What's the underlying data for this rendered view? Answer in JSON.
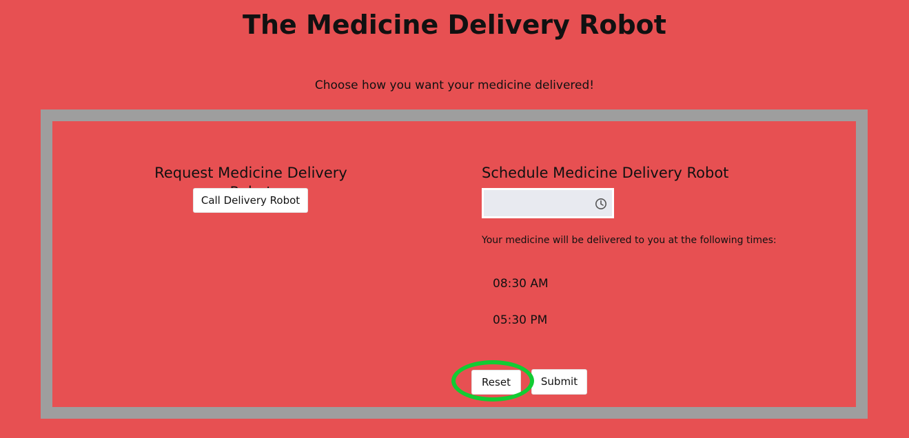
{
  "page": {
    "title": "The Medicine Delivery Robot",
    "subtitle": "Choose how you want your medicine delivered!"
  },
  "request_section": {
    "title": "Request Medicine Delivery Robot",
    "call_button_label": "Call Delivery Robot"
  },
  "schedule_section": {
    "title": "Schedule Medicine Delivery Robot",
    "time_input": {
      "value": "",
      "icon": "clock-icon"
    },
    "info_text": "Your medicine will be delivered to you at the following times:",
    "times": [
      "08:30 AM",
      "05:30 PM"
    ]
  },
  "actions": {
    "reset_label": "Reset",
    "submit_label": "Submit"
  },
  "annotation": {
    "highlight_color": "#11cc33",
    "highlighted_element": "reset-button"
  },
  "colors": {
    "background": "#e75052",
    "panel_border": "#9e9e9e",
    "input_background": "#e8eaf0"
  }
}
